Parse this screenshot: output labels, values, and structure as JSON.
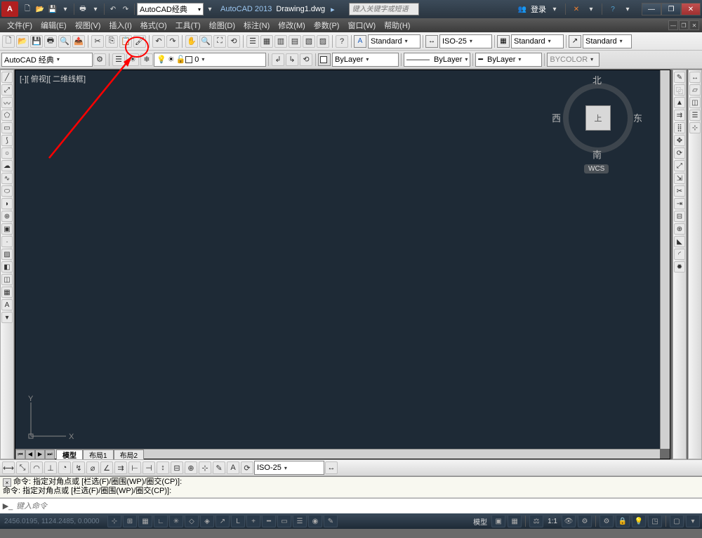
{
  "titlebar": {
    "workspace_selected": "AutoCAD经典",
    "app_title": "AutoCAD 2013",
    "file_name": "Drawing1.dwg",
    "search_placeholder": "键入关键字或短语",
    "login_label": "登录"
  },
  "menubar": {
    "items": [
      "文件(F)",
      "编辑(E)",
      "视图(V)",
      "插入(I)",
      "格式(O)",
      "工具(T)",
      "绘图(D)",
      "标注(N)",
      "修改(M)",
      "参数(P)",
      "窗口(W)",
      "帮助(H)"
    ]
  },
  "toolbar2": {
    "workspace": "AutoCAD 经典",
    "layer_selected": "0"
  },
  "styles": {
    "text_style": "Standard",
    "dim_style": "ISO-25",
    "table_style": "Standard",
    "mleader_style": "Standard"
  },
  "properties": {
    "color": "ByLayer",
    "linetype": "ByLayer",
    "lineweight": "ByLayer",
    "plotstyle": "BYCOLOR"
  },
  "viewport": {
    "label": "[-][ 俯视][ 二维线框]"
  },
  "viewcube": {
    "top": "上",
    "n": "北",
    "s": "南",
    "e": "东",
    "w": "西",
    "wcs": "WCS"
  },
  "ucs": {
    "x": "X",
    "y": "Y"
  },
  "tabs": {
    "model": "模型",
    "layout1": "布局1",
    "layout2": "布局2"
  },
  "dim_toolbar": {
    "style": "ISO-25"
  },
  "command": {
    "hist1": "命令: 指定对角点或 [栏选(F)/圈围(WP)/圈交(CP)]:",
    "hist2": "命令: 指定对角点或 [栏选(F)/圈围(WP)/圈交(CP)]:",
    "placeholder": "键入命令"
  },
  "statusbar": {
    "coords": "2456.0195, 1124.2485, 0.0000",
    "model_label": "模型",
    "scale": "1:1"
  }
}
